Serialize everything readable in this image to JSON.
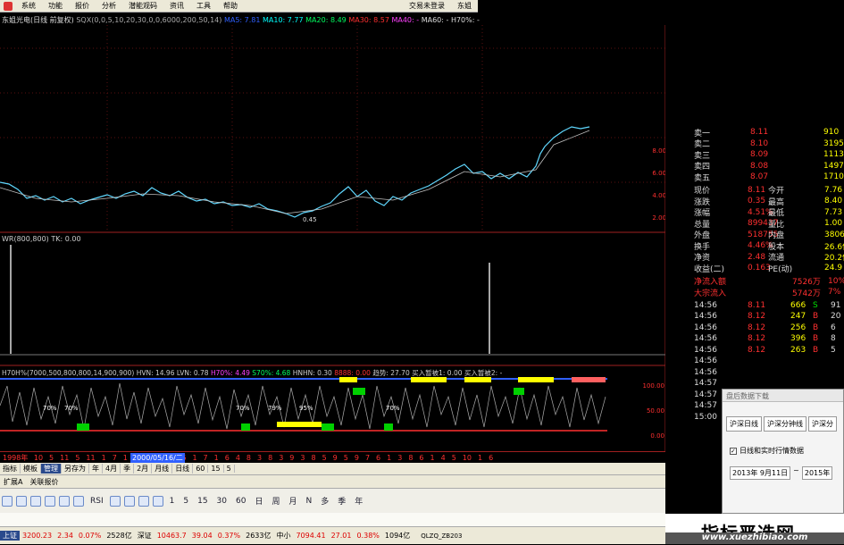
{
  "menu": {
    "items": [
      "系统",
      "功能",
      "报价",
      "分析",
      "潜能观码",
      "资讯",
      "工具",
      "帮助"
    ],
    "right": [
      "交易未登录",
      "东姐"
    ]
  },
  "chart_title": {
    "stock": "东姐光电(日线 前复权)",
    "param": "SQX(0,0,5,10,20,30,0,0,6000,200,50,14)",
    "ma5": "MA5: 7.81",
    "ma10": "MA10: 7.77",
    "ma20": "MA20: 8.49",
    "ma30": "MA30: 8.57",
    "ma40": "MA40: -",
    "ma60": "MA60: -",
    "h70": "H70%: -"
  },
  "price_axis": [
    "8.00",
    "6.00",
    "4.00",
    "2.00"
  ],
  "wr": {
    "label": "WR(800,800)",
    "tk": "TK: 0.00"
  },
  "h70ind": {
    "label": "H70H%(7000,500,800,800,14,900,900)",
    "hvn": "HVN: 14.96",
    "lvn": "LVN: 0.78",
    "h70": "H70%: 4.49",
    "s70": "S70%: 4.68",
    "hnhn": "HNHN: 0.30",
    "sig": "8888: 0.00",
    "trend": "趋势: 27.70",
    "buy1": "买入暂被1: 0.00",
    "buy2": "买入暂被2: -",
    "buy3": "买入信号1: 0.0"
  },
  "ind_axis": [
    "100.00",
    "50.00",
    "0.00"
  ],
  "timeline": {
    "year": "1998年",
    "date": "2000/05/16/二",
    "nums": [
      "10",
      "5",
      "11",
      "5",
      "11",
      "1",
      "7",
      "1",
      "9",
      "2",
      "6",
      "12",
      "6",
      "1",
      "7",
      "1",
      "6",
      "4",
      "8",
      "3",
      "8",
      "3",
      "9",
      "3",
      "8",
      "5",
      "9",
      "5",
      "9",
      "7",
      "6",
      "1",
      "3",
      "8",
      "6",
      "1",
      "4",
      "5",
      "10",
      "1",
      "6"
    ],
    "period": "日线"
  },
  "bottom_tabs": [
    "指标",
    "模板",
    "管理",
    "另存为",
    "年",
    "4月",
    "季",
    "2月",
    "月线",
    "日线",
    "60",
    "15",
    "5"
  ],
  "bottom_row2": [
    "扩展A",
    "关联报价"
  ],
  "toolbar_items": [
    "RSI",
    "1",
    "5",
    "15",
    "30",
    "60",
    "日",
    "周",
    "月",
    "N",
    "多",
    "季",
    "年"
  ],
  "quote": {
    "sell": [
      [
        "卖一",
        "8.11",
        "910"
      ],
      [
        "卖二",
        "8.10",
        "3195"
      ],
      [
        "卖三",
        "8.09",
        "1113"
      ],
      [
        "卖四",
        "8.08",
        "1497"
      ],
      [
        "卖五",
        "8.07",
        "1710"
      ]
    ],
    "stats": [
      [
        "现价",
        "8.11",
        "今开",
        "7.76"
      ],
      [
        "涨跌",
        "0.35",
        "最高",
        "8.40"
      ],
      [
        "涨幅",
        "4.51%",
        "最低",
        "7.73"
      ],
      [
        "总量",
        "899437",
        "量比",
        "1.00"
      ],
      [
        "外盘",
        "518755",
        "内盘",
        "380682"
      ],
      [
        "换手",
        "4.46%",
        "股本",
        "26.6亿"
      ],
      [
        "净资",
        "2.48",
        "流通",
        "20.2亿"
      ],
      [
        "收益(二)",
        "0.163",
        "PE(动)",
        "24.9"
      ]
    ],
    "flows": [
      [
        "净流入额",
        "7526万",
        "10%"
      ],
      [
        "大宗流入",
        "5742万",
        "7%"
      ]
    ],
    "ticks": [
      [
        "14:56",
        "8.11",
        "666",
        "S",
        "91"
      ],
      [
        "14:56",
        "8.12",
        "247",
        "B",
        "20"
      ],
      [
        "14:56",
        "8.12",
        "256",
        "B",
        "6"
      ],
      [
        "14:56",
        "8.12",
        "396",
        "B",
        "8"
      ],
      [
        "14:56",
        "8.12",
        "263",
        "B",
        "5"
      ],
      [
        "14:56",
        "",
        "",
        "",
        ""
      ],
      [
        "14:56",
        "",
        "",
        "",
        ""
      ],
      [
        "14:57",
        "",
        "",
        "",
        ""
      ],
      [
        "14:57",
        "",
        "",
        "",
        ""
      ],
      [
        "14:57",
        "",
        "",
        "",
        ""
      ],
      [
        "15:00",
        "",
        "",
        "",
        ""
      ]
    ]
  },
  "dialog": {
    "title": "盘后数据下载",
    "tabs": [
      "沪深日线",
      "沪深分钟线",
      "沪深分"
    ],
    "checkbox": "日线和实时行情数据",
    "date1": "2013年 9月11日",
    "date2": "2015年"
  },
  "status": {
    "sh_name": "上证",
    "sh_val": "3200.23",
    "sh_chg": "2.34",
    "sh_pct": "0.07%",
    "sh_amt": "2528亿",
    "sz_name": "深证",
    "sz_val": "10463.7",
    "sz_chg": "39.04",
    "sz_pct": "0.37%",
    "sz_amt": "2633亿",
    "zx_name": "中小",
    "zx_val": "7094.41",
    "zx_chg": "27.01",
    "zx_pct": "0.38%",
    "zx_amt": "1094亿",
    "srv": "QLZQ_ZB203"
  },
  "watermark": {
    "cn": "指标严选网",
    "url": "www.xuezhibiao.com"
  },
  "colors": {
    "red": "#ff3030",
    "yellow": "#ffff00",
    "green": "#00e000",
    "cyan": "#00ffff",
    "blue": "#3060ff"
  }
}
